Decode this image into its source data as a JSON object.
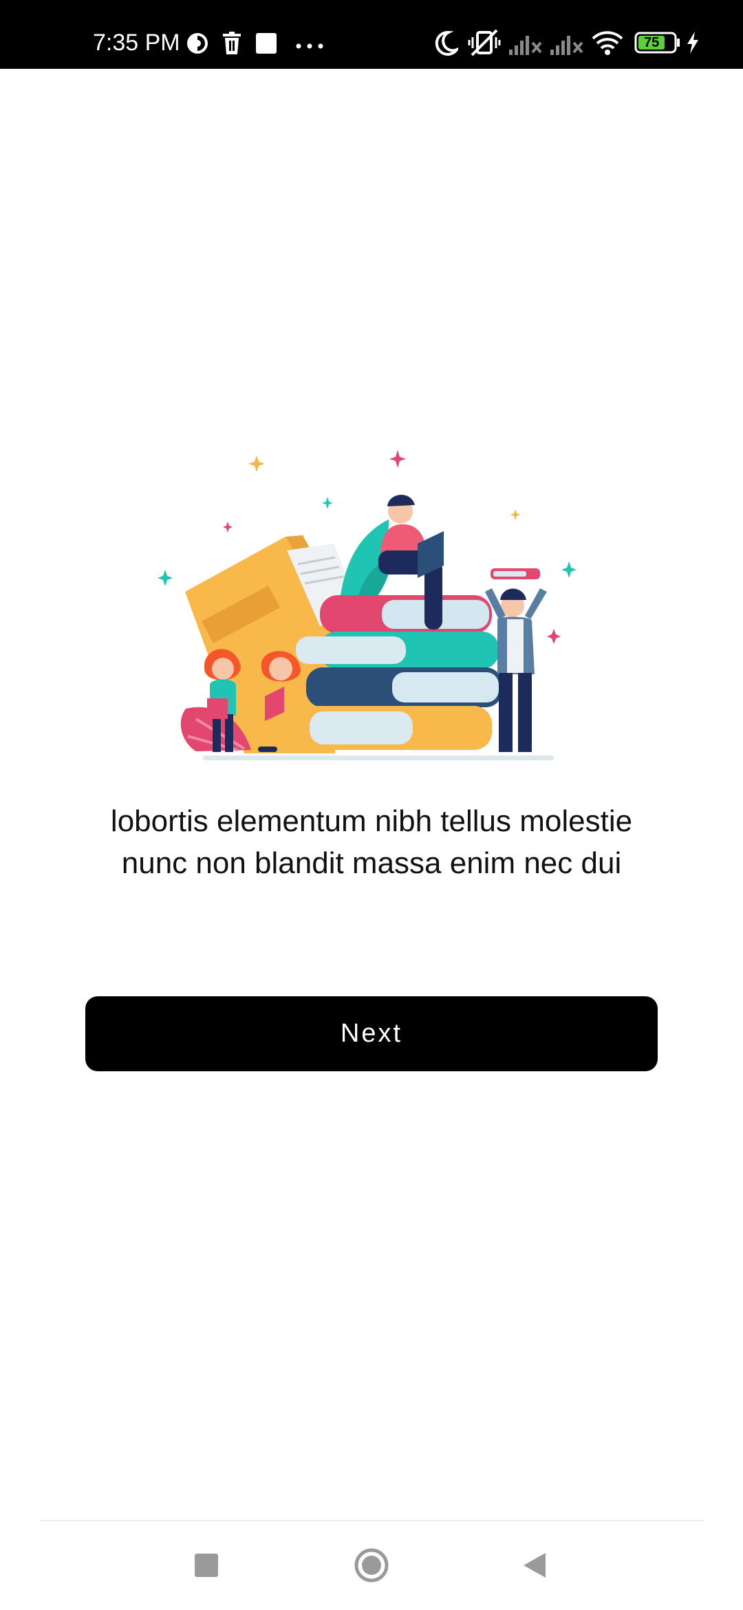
{
  "status_bar": {
    "time": "7:35 PM",
    "battery_level": "75",
    "icons": [
      "data-saver-icon",
      "trash-icon",
      "square-notification-icon",
      "more-dots-icon",
      "do-not-disturb-moon-icon",
      "vibrate-off-icon",
      "signal-x-icon",
      "signal-x-icon",
      "wifi-icon",
      "battery-icon",
      "charging-bolt-icon"
    ]
  },
  "onboarding": {
    "illustration": "people-reading-books-illustration",
    "caption": "lobortis elementum nibh tellus molestie nunc non blandit massa enim nec dui",
    "next_label": "Next"
  },
  "nav_bar": {
    "icons": [
      "recents-square-icon",
      "home-circle-icon",
      "back-triangle-icon"
    ]
  },
  "colors": {
    "button_bg": "#000000",
    "button_text": "#ffffff",
    "status_bar_bg": "#000000",
    "battery_fill": "#5bd03a"
  }
}
